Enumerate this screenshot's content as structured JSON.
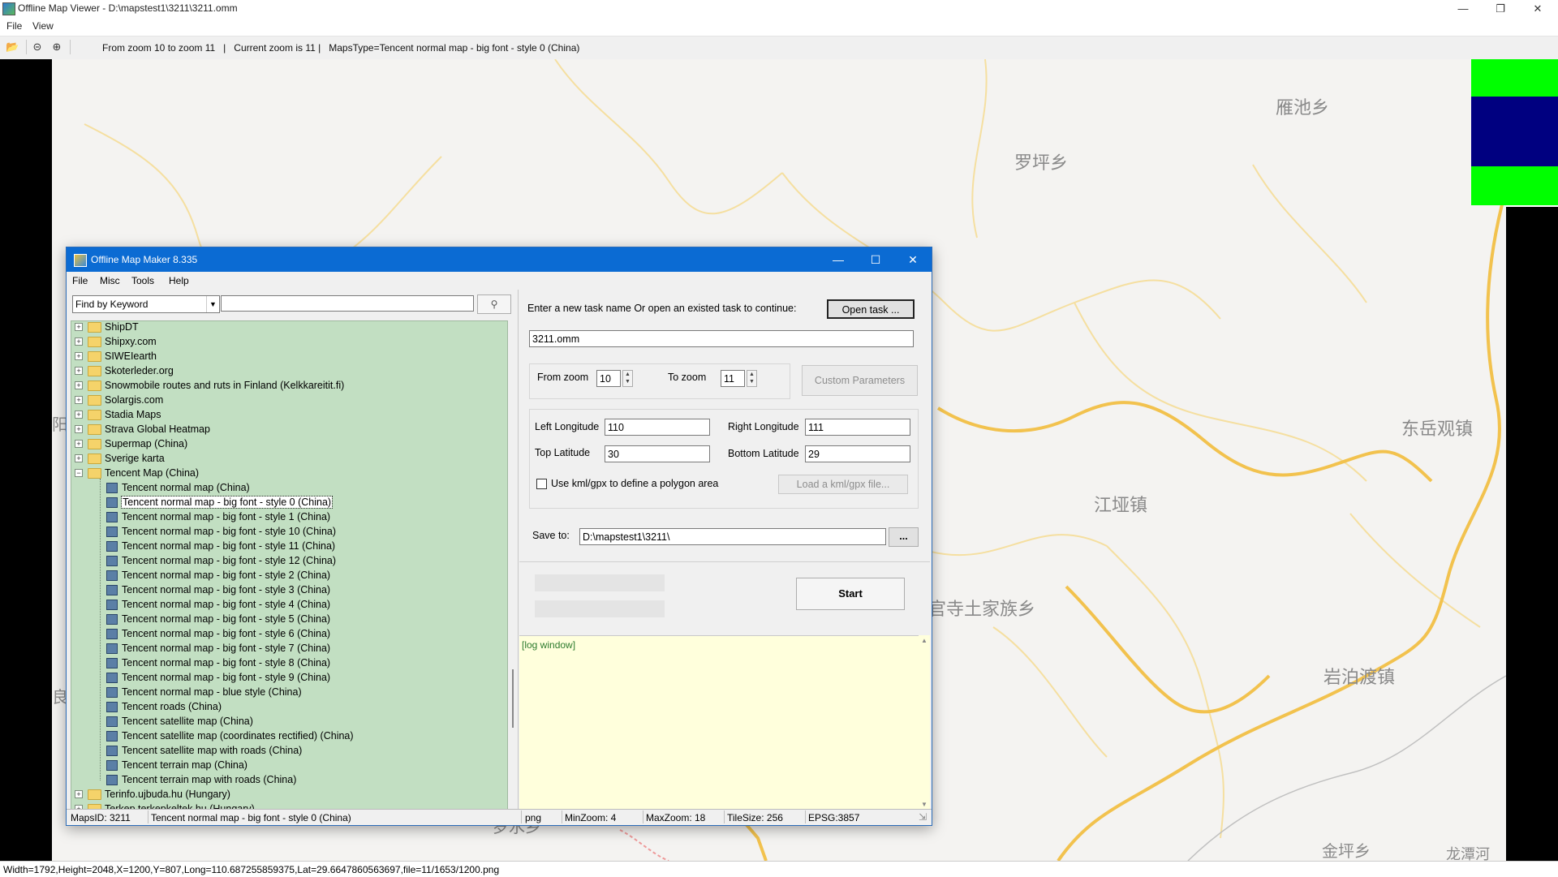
{
  "viewer": {
    "title": "Offline Map Viewer - D:\\mapstest1\\3211\\3211.omm",
    "menu": [
      "File",
      "View"
    ],
    "toolbar_text": "From zoom 10 to zoom 11   |   Current zoom is 11 |   MapsType=Tencent normal map - big font - style 0 (China)",
    "status": "Width=1792,Height=2048,X=1200,Y=807,Long=110.687255859375,Lat=29.6647860563697,file=11/1653/1200.png",
    "icons": [
      "folder-open-icon",
      "zoom-out-icon",
      "zoom-in-icon"
    ]
  },
  "map": {
    "places": [
      {
        "name": "雁池乡"
      },
      {
        "name": "罗坪乡"
      },
      {
        "name": "东岳观镇"
      },
      {
        "name": "江垭镇"
      },
      {
        "name": "官寺土家族乡"
      },
      {
        "name": "岩泊渡镇"
      },
      {
        "name": "金坪乡"
      },
      {
        "name": "龙潭河"
      },
      {
        "name": "罗水乡"
      },
      {
        "name": "阳乡"
      },
      {
        "name": "良"
      }
    ],
    "colors": {
      "road": "#f2c24e",
      "road_minor": "#f5dfa0",
      "background": "#f4f3f1",
      "tile_green": "#00ff00",
      "tile_blue": "#000080"
    }
  },
  "dialog": {
    "title": "Offline Map Maker 8.335",
    "menu": [
      "File",
      "Misc",
      "Tools",
      "Help"
    ],
    "find_mode": "Find by Keyword",
    "find_value": "",
    "tree_groups_before": [
      "ShipDT",
      "Shipxy.com",
      "SIWEIearth",
      "Skoterleder.org",
      "Snowmobile routes and ruts in Finland (Kelkkareitit.fi)",
      "Solargis.com",
      "Stadia Maps",
      "Strava Global Heatmap",
      "Supermap (China)",
      "Sverige karta"
    ],
    "tree_open_group": "Tencent Map (China)",
    "tree_children": [
      "Tencent normal map (China)",
      "Tencent normal map - big font - style 0 (China)",
      "Tencent normal map - big font - style 1 (China)",
      "Tencent normal map - big font - style 10 (China)",
      "Tencent normal map - big font - style 11 (China)",
      "Tencent normal map - big font - style 12 (China)",
      "Tencent normal map - big font - style 2 (China)",
      "Tencent normal map - big font - style 3 (China)",
      "Tencent normal map - big font - style 4 (China)",
      "Tencent normal map - big font - style 5 (China)",
      "Tencent normal map - big font - style 6 (China)",
      "Tencent normal map - big font - style 7 (China)",
      "Tencent normal map - big font - style 8 (China)",
      "Tencent normal map - big font - style 9 (China)",
      "Tencent normal map - blue style (China)",
      "Tencent roads (China)",
      "Tencent satellite map (China)",
      "Tencent satellite map (coordinates rectified) (China)",
      "Tencent satellite map with roads (China)",
      "Tencent terrain map (China)",
      "Tencent terrain map with roads (China)"
    ],
    "tree_selected_index": 1,
    "tree_groups_after": [
      "Terinfo.ujbuda.hu (Hungary)",
      "Terkep.terkepkeltek.hu (Hungary)"
    ],
    "task_prompt": "Enter a new task name Or open an existed task to continue:",
    "open_task": "Open task ...",
    "task_name": "3211.omm",
    "from_zoom_label": "From zoom",
    "from_zoom": "10",
    "to_zoom_label": "To zoom",
    "to_zoom": "11",
    "custom_params": "Custom Parameters",
    "left_lon_label": "Left Longitude",
    "left_lon": "110",
    "right_lon_label": "Right Longitude",
    "right_lon": "111",
    "top_lat_label": "Top Latitude",
    "top_lat": "30",
    "bottom_lat_label": "Bottom Latitude",
    "bottom_lat": "29",
    "kml_label": "Use kml/gpx to define a polygon area",
    "kml_checked": false,
    "kml_button": "Load a kml/gpx file...",
    "save_label": "Save to:",
    "save_path": "D:\\mapstest1\\3211\\",
    "browse": "...",
    "start": "Start",
    "log": "[log window]",
    "status": {
      "maps_id": "MapsID: 3211",
      "maps_name": "Tencent normal map - big font - style 0 (China)",
      "format": "png",
      "min_zoom": "MinZoom: 4",
      "max_zoom": "MaxZoom: 18",
      "tile_size": "TileSize: 256",
      "epsg": "EPSG:3857"
    }
  }
}
